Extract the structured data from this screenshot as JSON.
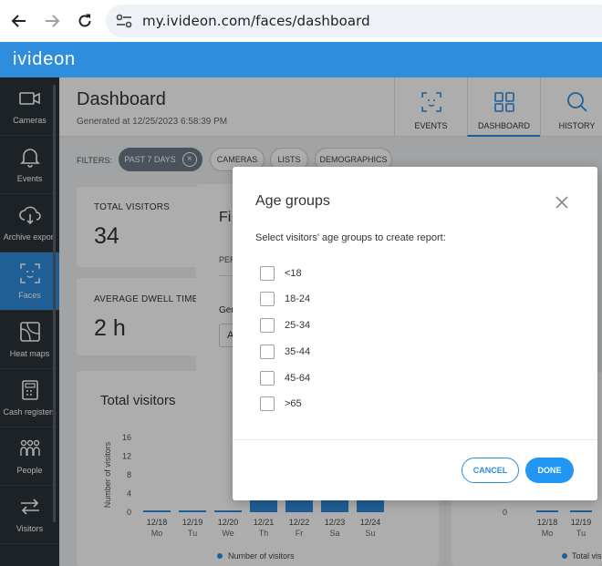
{
  "browser": {
    "url": "my.ivideon.com/faces/dashboard"
  },
  "app": {
    "logo": "ivideon",
    "accent": "#2e8ddd"
  },
  "sidebar": {
    "items": [
      {
        "label": "Cameras",
        "icon": "camera-icon"
      },
      {
        "label": "Events",
        "icon": "bell-icon"
      },
      {
        "label": "Archive export",
        "icon": "cloud-download-icon"
      },
      {
        "label": "Faces",
        "icon": "face-scan-icon",
        "active": true
      },
      {
        "label": "Heat maps",
        "icon": "heatmap-icon"
      },
      {
        "label": "Cash registers",
        "icon": "cash-register-icon"
      },
      {
        "label": "People",
        "icon": "people-icon"
      },
      {
        "label": "Visitors",
        "icon": "arrows-icon"
      }
    ]
  },
  "header": {
    "title": "Dashboard",
    "generated": "Generated at 12/25/2023 6:58:39 PM",
    "tabs": [
      {
        "label": "EVENTS",
        "icon": "face-scan-icon"
      },
      {
        "label": "DASHBOARD",
        "icon": "grid-icon",
        "active": true
      },
      {
        "label": "HISTORY",
        "icon": "search-icon"
      }
    ]
  },
  "filters": {
    "label": "FILTERS:",
    "chips": [
      "PAST 7 DAYS",
      "CAMERAS",
      "LISTS",
      "DEMOGRAPHICS"
    ]
  },
  "cards": {
    "total_visitors_label": "TOTAL VISITORS",
    "total_visitors_value": "34",
    "dwell_label": "AVERAGE DWELL TIME",
    "dwell_value": "2 h",
    "behind_partial": {
      "title": "Fi",
      "per": "PER",
      "gen": "Ger",
      "a": "A"
    }
  },
  "chart": {
    "title": "Total visitors",
    "ylabel": "Number of visitors",
    "legend": "Number of visitors",
    "right_legend": "Total vis"
  },
  "chart_data": [
    {
      "type": "bar",
      "title": "Total visitors",
      "ylabel": "Number of visitors",
      "categories": [
        "12/18 Mo",
        "12/19 Tu",
        "12/20 We",
        "12/21 Th",
        "12/22 Fr",
        "12/23 Sa",
        "12/24 Su"
      ],
      "x_dates": [
        "12/18",
        "12/19",
        "12/20",
        "12/21",
        "12/22",
        "12/23",
        "12/24"
      ],
      "x_days": [
        "Mo",
        "Tu",
        "We",
        "Th",
        "Fr",
        "Sa",
        "Su"
      ],
      "yticks": [
        "16",
        "12",
        "8",
        "4",
        "0"
      ],
      "ylim": [
        0,
        16
      ],
      "series": [
        {
          "name": "Number of visitors",
          "values": [
            0,
            0,
            0,
            8,
            9,
            8,
            9
          ]
        }
      ],
      "color": "#2e8ddd",
      "legend": "bottom"
    },
    {
      "type": "bar",
      "x_dates": [
        "12/18",
        "12/19"
      ],
      "x_days": [
        "Mo",
        "Tu"
      ],
      "yticks": [
        "0"
      ],
      "series": [
        {
          "name": "Total vis",
          "values": [
            0,
            0
          ]
        }
      ],
      "legend": "bottom"
    }
  ],
  "modal": {
    "title": "Age groups",
    "subtitle": "Select visitors' age groups to create report:",
    "options": [
      "<18",
      "18-24",
      "25-34",
      "35-44",
      "45-64",
      ">65"
    ],
    "cancel": "CANCEL",
    "done": "DONE"
  }
}
